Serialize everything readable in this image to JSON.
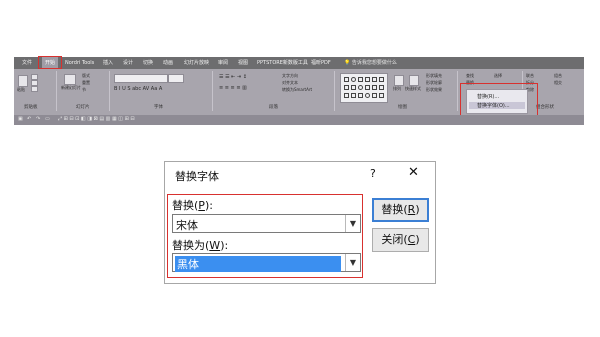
{
  "ribbon": {
    "tabs": [
      "文件",
      "开始",
      "Nordri Tools",
      "插入",
      "设计",
      "切换",
      "动画",
      "幻灯片放映",
      "审阅",
      "视图",
      "PPTSTORE新数版工具",
      "福昕PDF"
    ],
    "tell_me": "告诉我您想要做什么",
    "groups": [
      "剪贴板",
      "幻灯片",
      "字体",
      "段落",
      "绘图",
      "编辑",
      "组合形状"
    ],
    "small_labels": [
      "粘贴",
      "新建幻灯片",
      "版式",
      "重置",
      "节",
      "文字方向",
      "对齐文本",
      "转换为SmartArt",
      "排列",
      "快速样式",
      "形状填充",
      "形状轮廓",
      "形状效果",
      "查找",
      "替换",
      "选择",
      "联合",
      "组合",
      "拆分",
      "相交",
      "剪除"
    ],
    "replace_menu": {
      "items": [
        "替换(R)...",
        "替换字体(O)..."
      ],
      "highlighted_index": 1
    }
  },
  "dialog": {
    "title": "替换字体",
    "help": "?",
    "close": "✕",
    "replace_label": "替换(",
    "replace_key": "P",
    "replace_label_end": "):",
    "replace_value": "宋体",
    "with_label": "替换为(",
    "with_key": "W",
    "with_label_end": "):",
    "with_value": "黑体",
    "replace_button": "替换(",
    "replace_button_key": "R",
    "replace_button_end": ")",
    "close_button": "关闭(",
    "close_button_key": "C",
    "close_button_end": ")"
  },
  "colors": {
    "highlight_red": "#d8312f",
    "selection_blue": "#3b8ff0",
    "default_button_border": "#3b7fd4"
  }
}
